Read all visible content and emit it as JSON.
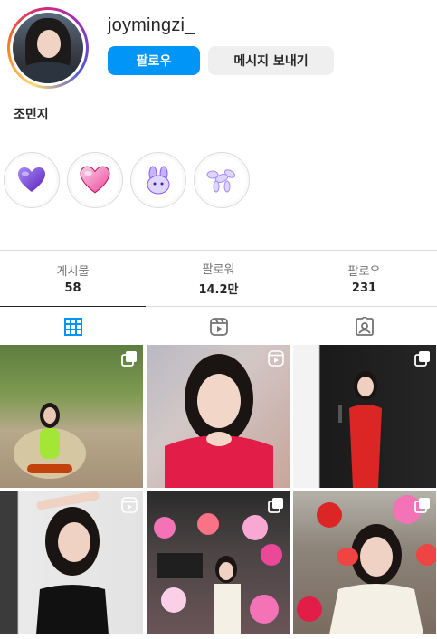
{
  "profile": {
    "username": "joymingzi_",
    "display_name": "조민지",
    "follow_label": "팔로우",
    "message_label": "메시지 보내기"
  },
  "highlights": [
    {
      "icon": "purple-heart-icon"
    },
    {
      "icon": "pink-heart-icon"
    },
    {
      "icon": "bunny-icon"
    },
    {
      "icon": "balloon-dog-icon"
    }
  ],
  "stats": [
    {
      "label": "게시물",
      "value": "58"
    },
    {
      "label": "팔로워",
      "value": "14.2만"
    },
    {
      "label": "팔로우",
      "value": "231"
    }
  ],
  "tabs": [
    {
      "icon": "grid-icon",
      "active": true
    },
    {
      "icon": "reels-icon",
      "active": false
    },
    {
      "icon": "tagged-icon",
      "active": false
    }
  ],
  "posts": [
    {
      "badge": "carousel-icon"
    },
    {
      "badge": "reels-icon"
    },
    {
      "badge": "carousel-icon"
    },
    {
      "badge": "reels-icon"
    },
    {
      "badge": "carousel-icon"
    },
    {
      "badge": "carousel-icon"
    }
  ],
  "colors": {
    "accent": "#0095f6",
    "active_tab": "#0095f6",
    "inactive_icon": "#737373"
  }
}
